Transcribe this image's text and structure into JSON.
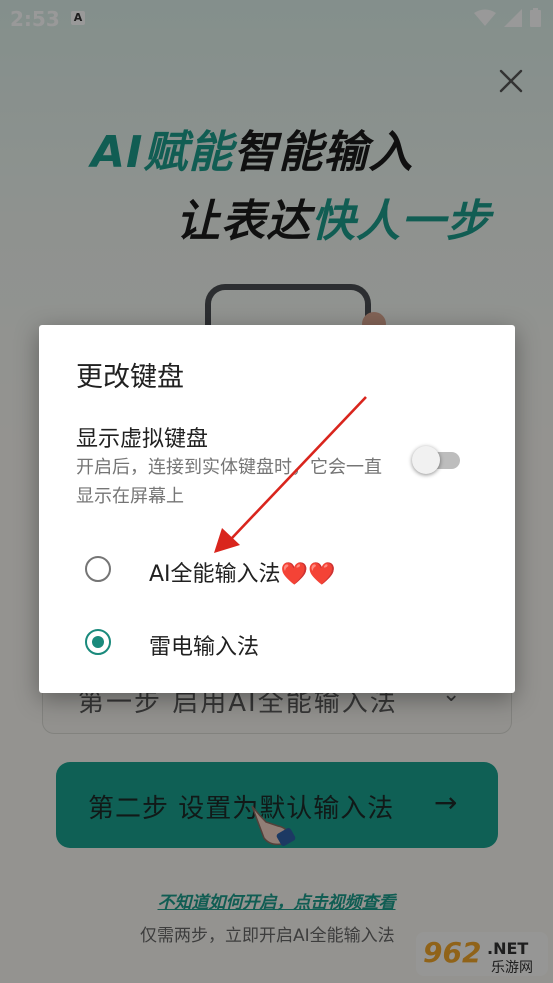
{
  "status_bar": {
    "time": "2:53",
    "badge": "A"
  },
  "hero": {
    "line1_teal": "AI赋能",
    "line1_dark": "智能输入",
    "line2_dark": "让表达",
    "line2_teal": "快人一步"
  },
  "step1": {
    "label": "第一步 启用AI全能输入法",
    "chevron": "⌄"
  },
  "step2": {
    "label": "第二步  设置为默认输入法",
    "arrow": "→"
  },
  "help": {
    "link": "不知道如何开启，点击视频查看",
    "desc": "仅需两步，立即开启AI全能输入法"
  },
  "watermark": {
    "text1": "962",
    "text2": ".NET",
    "text3": "乐游网"
  },
  "dialog": {
    "title": "更改键盘",
    "virtual_keyboard": {
      "title": "显示虚拟键盘",
      "description": "开启后，连接到实体键盘时，它会一直显示在屏幕上",
      "enabled": false
    },
    "options": [
      {
        "label": "AI全能输入法",
        "suffix": "❤️❤️",
        "selected": false
      },
      {
        "label": "雷电输入法",
        "suffix": "",
        "selected": true
      }
    ]
  },
  "colors": {
    "accent": "#1a8a7c",
    "brand_teal": "#1aa08e",
    "arrow_red": "#d9251d"
  }
}
